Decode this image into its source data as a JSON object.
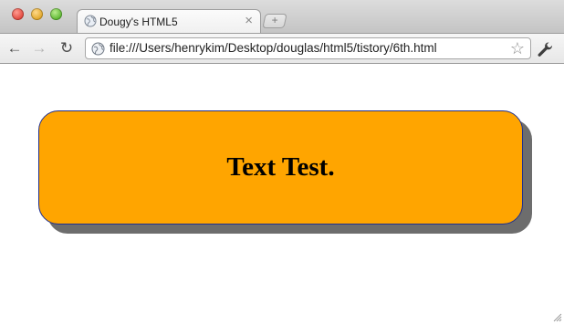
{
  "tab": {
    "title": "Dougy's HTML5",
    "close_glyph": "×",
    "favicon": "globe-icon"
  },
  "new_tab": {
    "glyph": "+"
  },
  "toolbar": {
    "back_glyph": "←",
    "forward_glyph": "→",
    "reload_glyph": "↻",
    "url": "file:///Users/henrykim/Desktop/douglas/html5/tistory/6th.html",
    "bookmark_glyph": "☆",
    "menu_icon": "wrench-icon"
  },
  "page": {
    "box_text": "Text Test.",
    "box_color": "#ffa500",
    "box_border_color": "#1f2f8f",
    "shadow_color": "#6d6d6d"
  }
}
